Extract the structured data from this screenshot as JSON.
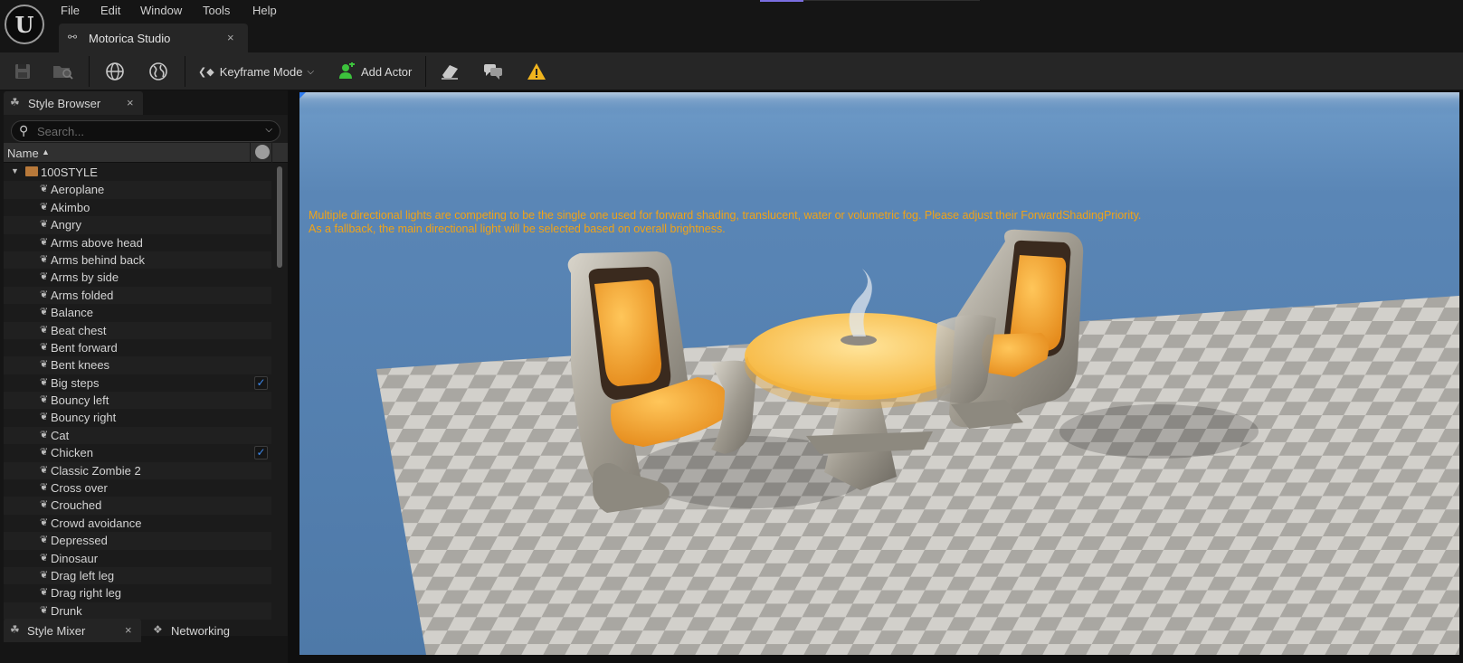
{
  "menu": {
    "logo_text": "U",
    "items": [
      "File",
      "Edit",
      "Window",
      "Tools",
      "Help"
    ]
  },
  "document_tab": {
    "label": "Motorica Studio",
    "close": "×"
  },
  "toolbar": {
    "keyframe_mode_label": "Keyframe Mode",
    "add_actor_label": "Add Actor",
    "warning_color": "#f0b41e",
    "add_actor_icon_color": "#3cc23c"
  },
  "style_browser": {
    "tab_label": "Style Browser",
    "close": "×",
    "search_placeholder": "Search...",
    "column_name": "Name",
    "folder": "100STYLE",
    "items": [
      {
        "label": "Aeroplane",
        "checked": false
      },
      {
        "label": "Akimbo",
        "checked": false
      },
      {
        "label": "Angry",
        "checked": false
      },
      {
        "label": "Arms above head",
        "checked": false
      },
      {
        "label": "Arms behind back",
        "checked": false
      },
      {
        "label": "Arms by side",
        "checked": false
      },
      {
        "label": "Arms folded",
        "checked": false
      },
      {
        "label": "Balance",
        "checked": false
      },
      {
        "label": "Beat chest",
        "checked": false
      },
      {
        "label": "Bent forward",
        "checked": false
      },
      {
        "label": "Bent knees",
        "checked": false
      },
      {
        "label": "Big steps",
        "checked": true
      },
      {
        "label": "Bouncy left",
        "checked": false
      },
      {
        "label": "Bouncy right",
        "checked": false
      },
      {
        "label": "Cat",
        "checked": false
      },
      {
        "label": "Chicken",
        "checked": true
      },
      {
        "label": "Classic Zombie 2",
        "checked": false
      },
      {
        "label": "Cross over",
        "checked": false
      },
      {
        "label": "Crouched",
        "checked": false
      },
      {
        "label": "Crowd avoidance",
        "checked": false
      },
      {
        "label": "Depressed",
        "checked": false
      },
      {
        "label": "Dinosaur",
        "checked": false
      },
      {
        "label": "Drag left leg",
        "checked": false
      },
      {
        "label": "Drag right leg",
        "checked": false
      },
      {
        "label": "Drunk",
        "checked": false
      }
    ]
  },
  "bottom_tabs": {
    "style_mixer_label": "Style Mixer",
    "close": "×",
    "networking_label": "Networking"
  },
  "viewport": {
    "warning_line1": "Multiple directional lights are competing to be the single one used for forward shading, translucent, water or volumetric fog. Please adjust their ForwardShadingPriority.",
    "warning_line2": "As a fallback, the main directional light will be selected based on overall brightness.",
    "warning_text_color": "#f0a318",
    "sky_color": "#4e79a8",
    "floor_colors": [
      "#d2d0cb",
      "#a9a7a2"
    ],
    "seat_color": "#f6a933",
    "frame_color": "#a8a49b"
  }
}
